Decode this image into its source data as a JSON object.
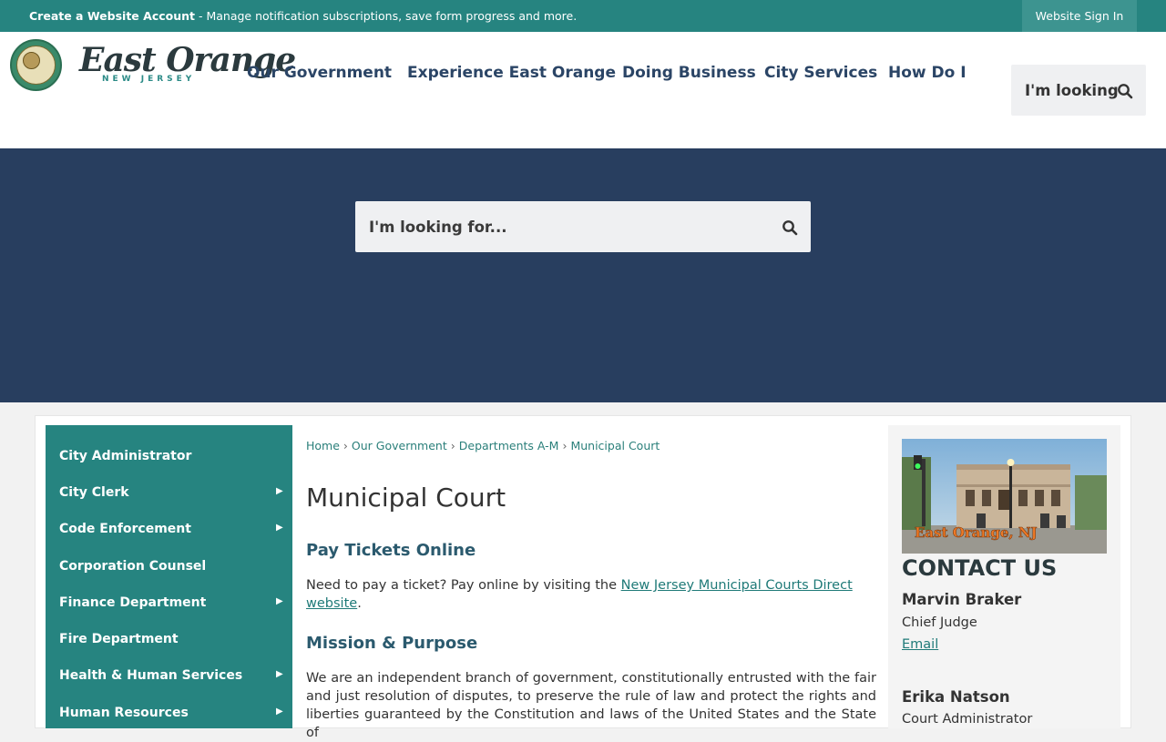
{
  "topbar": {
    "create_account": "Create a Website Account",
    "message": " - Manage notification subscriptions, save form progress and more.",
    "sign_in": "Website Sign In"
  },
  "logo": {
    "name": "East Orange",
    "state": "NEW JERSEY"
  },
  "nav": {
    "items": [
      "Our Government",
      "Experience East Orange",
      "Doing Business",
      "City Services",
      "How Do I"
    ],
    "looking_button": "I'm looking"
  },
  "hero": {
    "search_placeholder": "I'm looking for..."
  },
  "sidebar": {
    "items": [
      {
        "label": "City Administrator",
        "has_submenu": false
      },
      {
        "label": "City Clerk",
        "has_submenu": true
      },
      {
        "label": "Code Enforcement",
        "has_submenu": true
      },
      {
        "label": "Corporation Counsel",
        "has_submenu": false
      },
      {
        "label": "Finance Department",
        "has_submenu": true
      },
      {
        "label": "Fire Department",
        "has_submenu": false
      },
      {
        "label": "Health & Human Services",
        "has_submenu": true
      },
      {
        "label": "Human Resources",
        "has_submenu": true
      }
    ]
  },
  "breadcrumb": [
    "Home",
    "Our Government",
    "Departments A-M",
    "Municipal Court"
  ],
  "main": {
    "title": "Municipal Court",
    "pay_heading": "Pay Tickets Online",
    "pay_text_before": "Need to pay a ticket? Pay online by visiting the ",
    "pay_link": "New Jersey Municipal Courts Direct website",
    "pay_text_after": ".",
    "mission_heading": "Mission & Purpose",
    "mission_text": "We are an independent branch of government, constitutionally entrusted with the fair and just resolution of disputes, to preserve the rule of law and protect the rights and liberties guaranteed by the Constitution and laws of the United States and the State of"
  },
  "contact": {
    "photo_caption": "East Orange, NJ",
    "heading": "CONTACT US",
    "people": [
      {
        "name": "Marvin Braker",
        "role": "Chief Judge",
        "link": "Email"
      },
      {
        "name": "Erika Natson",
        "role": "Court Administrator"
      }
    ]
  },
  "colors": {
    "teal": "#268480",
    "navy": "#283e5f",
    "nav_text": "#2b4566",
    "link": "#1f7a78"
  }
}
